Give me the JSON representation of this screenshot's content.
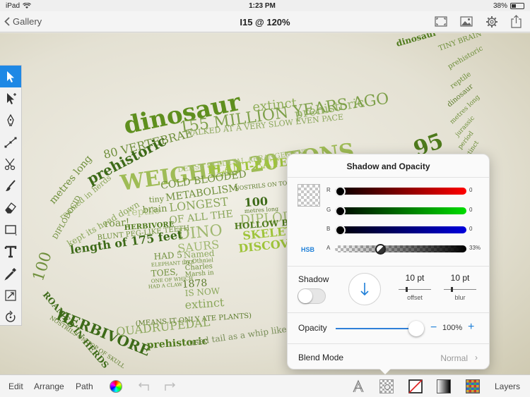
{
  "status": {
    "device": "iPad",
    "time": "1:23 PM",
    "battery": "38%",
    "battery_level": 0.38
  },
  "nav": {
    "back_label": "Gallery",
    "title": "I15 @ 120%"
  },
  "tools": [
    {
      "name": "select-tool-icon",
      "active": true
    },
    {
      "name": "direct-select-tool-icon",
      "active": false
    },
    {
      "name": "pen-tool-icon",
      "active": false
    },
    {
      "name": "node-tool-icon",
      "active": false
    },
    {
      "name": "scissors-tool-icon",
      "active": false
    },
    {
      "name": "brush-tool-icon",
      "active": false
    },
    {
      "name": "eraser-tool-icon",
      "active": false
    },
    {
      "name": "rectangle-tool-icon",
      "active": false
    },
    {
      "name": "text-tool-icon",
      "active": false
    },
    {
      "name": "eyedropper-tool-icon",
      "active": false
    },
    {
      "name": "transform-tool-icon",
      "active": false
    },
    {
      "name": "rotate-tool-icon",
      "active": false
    }
  ],
  "artwork": {
    "words": [
      {
        "t": "dinosaur",
        "c": "#5f8f1e",
        "fs": 34,
        "w": "bold"
      },
      {
        "t": "extinct",
        "c": "#8fae5a",
        "fs": 18
      },
      {
        "t": "prehistoric",
        "c": "#97b46a",
        "fs": 18
      },
      {
        "t": "155 MILLION YEARS AGO",
        "c": "#7ea04a",
        "fs": 22
      },
      {
        "t": "80 VERTEBRAE",
        "c": "#6f8f3c",
        "fs": 16
      },
      {
        "t": "WALKED AT A VERY SLOW EVEN PACE",
        "c": "#8aa65a",
        "fs": 11
      },
      {
        "t": "WEIGHED 20 TONS",
        "c": "#9fbc56",
        "fs": 30,
        "w": "bold"
      },
      {
        "t": "prehistoric",
        "c": "#3d6a18",
        "fs": 20,
        "w": "bold"
      },
      {
        "t": "DENSE SKELETAL ARRANGEMENT",
        "c": "#a6bd7a",
        "fs": 10
      },
      {
        "t": "PLANT-EATER",
        "c": "#9fc43a",
        "fs": 16,
        "w": "bold"
      },
      {
        "t": "COLD BLOODED",
        "c": "#6f8f3c",
        "fs": 14
      },
      {
        "t": "METABOLISM",
        "c": "#6f8f3c",
        "fs": 14
      },
      {
        "t": "NOSTRILS ON TOP OF THEIR SKULL",
        "c": "#5c7b2c",
        "fs": 8
      },
      {
        "t": "LONGEST",
        "c": "#8aa65a",
        "fs": 16
      },
      {
        "t": "OF ALL THE",
        "c": "#8aa65a",
        "fs": 14
      },
      {
        "t": "DINO",
        "c": "#a0b870",
        "fs": 22
      },
      {
        "t": "SAURS",
        "c": "#a0b870",
        "fs": 16
      },
      {
        "t": "100",
        "c": "#3d6a18",
        "fs": 16,
        "w": "bold"
      },
      {
        "t": "metres long",
        "c": "#5c7b2c",
        "fs": 8
      },
      {
        "t": "DIPLODOCUS",
        "c": "#a0b870",
        "fs": 18
      },
      {
        "t": "HOLLOW BACK",
        "c": "#4e7a1c",
        "fs": 12,
        "w": "bold"
      },
      {
        "t": "SKELETONS",
        "c": "#9fc43a",
        "fs": 16,
        "w": "bold"
      },
      {
        "t": "DISCOVERED",
        "c": "#9fc43a",
        "fs": 16,
        "w": "bold"
      },
      {
        "t": "HAD 5",
        "c": "#6f8f3c",
        "fs": 12
      },
      {
        "t": "ELEPHANT LIKE",
        "c": "#6f8f3c",
        "fs": 7
      },
      {
        "t": "TOES,",
        "c": "#6f8f3c",
        "fs": 12
      },
      {
        "t": "ONE OF WHICH",
        "c": "#6f8f3c",
        "fs": 7
      },
      {
        "t": "HAD A CLAW",
        "c": "#6f8f3c",
        "fs": 7
      },
      {
        "t": "Named",
        "c": "#8aa65a",
        "fs": 12
      },
      {
        "t": "by Othniel",
        "c": "#6f8f3c",
        "fs": 8
      },
      {
        "t": "Charles",
        "c": "#6f8f3c",
        "fs": 10
      },
      {
        "t": "Marsh in",
        "c": "#6f8f3c",
        "fs": 9
      },
      {
        "t": "1878",
        "c": "#5c7b2c",
        "fs": 14
      },
      {
        "t": "IS NOW",
        "c": "#8aa65a",
        "fs": 12
      },
      {
        "t": "extinct",
        "c": "#8aa65a",
        "fs": 16
      },
      {
        "t": "reptile",
        "c": "#b2c48a",
        "fs": 14
      },
      {
        "t": "HERBIVORE",
        "c": "#4e7a1c",
        "fs": 10,
        "w": "bold"
      },
      {
        "t": "tiny",
        "c": "#6f8f3c",
        "fs": 11
      },
      {
        "t": "brain",
        "c": "#6f8f3c",
        "fs": 13
      },
      {
        "t": "roar!",
        "c": "#6f8f3c",
        "fs": 14
      },
      {
        "t": "BLUNT PEG-LIKE TEETH",
        "c": "#6f8f3c",
        "fs": 10
      },
      {
        "t": "length of 175 feet",
        "c": "#3d6a18",
        "fs": 16,
        "w": "bold"
      },
      {
        "t": "kept its head down",
        "c": "#8aa65a",
        "fs": 12
      },
      {
        "t": "roamed in herds",
        "c": "#8aa65a",
        "fs": 11
      },
      {
        "t": "metres long",
        "c": "#6f8f3c",
        "fs": 14
      },
      {
        "t": "DIPLODOCID",
        "c": "#6f8f3c",
        "fs": 10
      },
      {
        "t": "100",
        "c": "#6f8f3c",
        "fs": 22
      },
      {
        "t": "HERBIVORE",
        "c": "#3d6a18",
        "fs": 20,
        "w": "bold"
      },
      {
        "t": "ROAMED IN HERDS",
        "c": "#3d6a18",
        "fs": 12,
        "w": "bold"
      },
      {
        "t": "NOSTRILS ON TOP OF SKULL",
        "c": "#5c7b2c",
        "fs": 8
      },
      {
        "t": "(MEANS IT ONLY ATE PLANTS)",
        "c": "#5c7b2c",
        "fs": 10
      },
      {
        "t": "QUADRUPEDAL",
        "c": "#8aa65a",
        "fs": 16
      },
      {
        "t": "prehistoric",
        "c": "#4e7a1c",
        "fs": 14,
        "w": "bold"
      },
      {
        "t": "used tail as a whip like",
        "c": "#7a8f5a",
        "fs": 12
      },
      {
        "t": "dinosaur",
        "c": "#4e7a1c",
        "fs": 12,
        "w": "bold"
      },
      {
        "t": "TINY BRAIN",
        "c": "#6f8f3c",
        "fs": 10
      },
      {
        "t": "prehistoric",
        "c": "#6f8f3c",
        "fs": 10
      },
      {
        "t": "reptile",
        "c": "#6f8f3c",
        "fs": 10
      },
      {
        "t": "dinosaur",
        "c": "#5c7b2c",
        "fs": 10
      },
      {
        "t": "metres long",
        "c": "#6f8f3c",
        "fs": 9
      },
      {
        "t": "jurassic",
        "c": "#6f8f3c",
        "fs": 9
      },
      {
        "t": "period",
        "c": "#6f8f3c",
        "fs": 9
      },
      {
        "t": "extinct",
        "c": "#6f8f3c",
        "fs": 9
      },
      {
        "t": "plant",
        "c": "#6f8f3c",
        "fs": 9
      },
      {
        "t": "eater",
        "c": "#6f8f3c",
        "fs": 9
      },
      {
        "t": "95",
        "c": "#4e7a1c",
        "fs": 30,
        "w": "bold"
      }
    ]
  },
  "popover": {
    "title": "Shadow and Opacity",
    "color_mode": "HSB",
    "channels": [
      {
        "label": "R",
        "value": "0",
        "from": "#000000",
        "to": "#ff0000",
        "pos": 0.0
      },
      {
        "label": "G",
        "value": "0",
        "from": "#000000",
        "to": "#00dd00",
        "pos": 0.0
      },
      {
        "label": "B",
        "value": "0",
        "from": "#000000",
        "to": "#0000dd",
        "pos": 0.0
      },
      {
        "label": "A",
        "value": "33%",
        "from": "transparent",
        "to": "#000000",
        "pos": 0.33
      }
    ],
    "shadow_label": "Shadow",
    "shadow_enabled": false,
    "offset_value": "10 pt",
    "offset_caption": "offset",
    "blur_value": "10 pt",
    "blur_caption": "blur",
    "opacity_label": "Opacity",
    "opacity_value": "100%",
    "opacity_level": 1.0,
    "blend_label": "Blend Mode",
    "blend_value": "Normal"
  },
  "bottom": {
    "edit": "Edit",
    "arrange": "Arrange",
    "path": "Path",
    "layers": "Layers"
  }
}
